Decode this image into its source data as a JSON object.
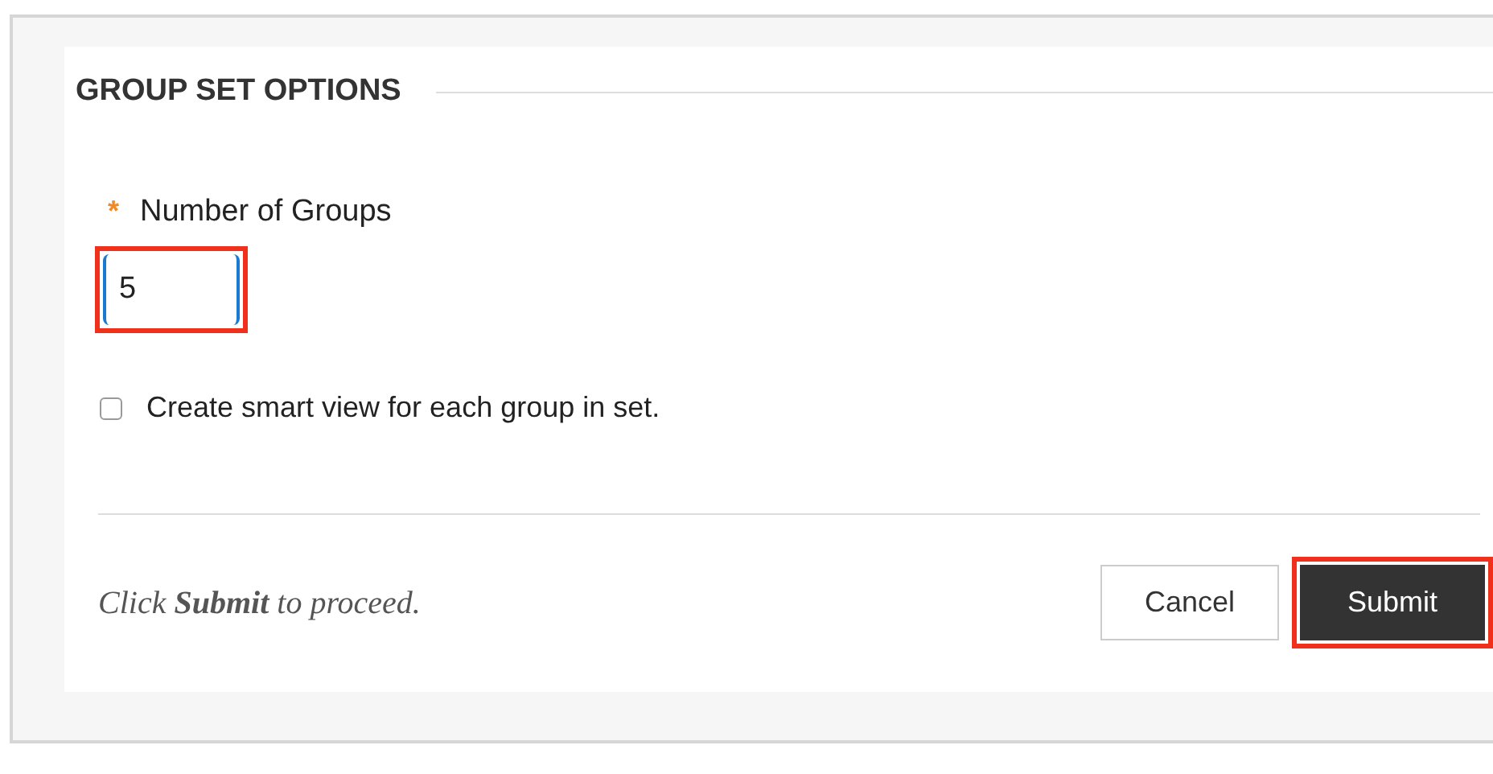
{
  "section": {
    "title": "GROUP SET OPTIONS"
  },
  "number_field": {
    "required_mark": "*",
    "label": "Number of Groups",
    "value": "5",
    "highlighted": true
  },
  "smart_view": {
    "label": "Create smart view for each group in set.",
    "checked": false
  },
  "footer": {
    "instruction": "Click **Submit** to proceed."
  },
  "buttons": [
    {
      "label": "Cancel",
      "kind": "secondary",
      "highlighted": false
    },
    {
      "label": "Submit",
      "kind": "primary",
      "highlighted": true
    }
  ]
}
